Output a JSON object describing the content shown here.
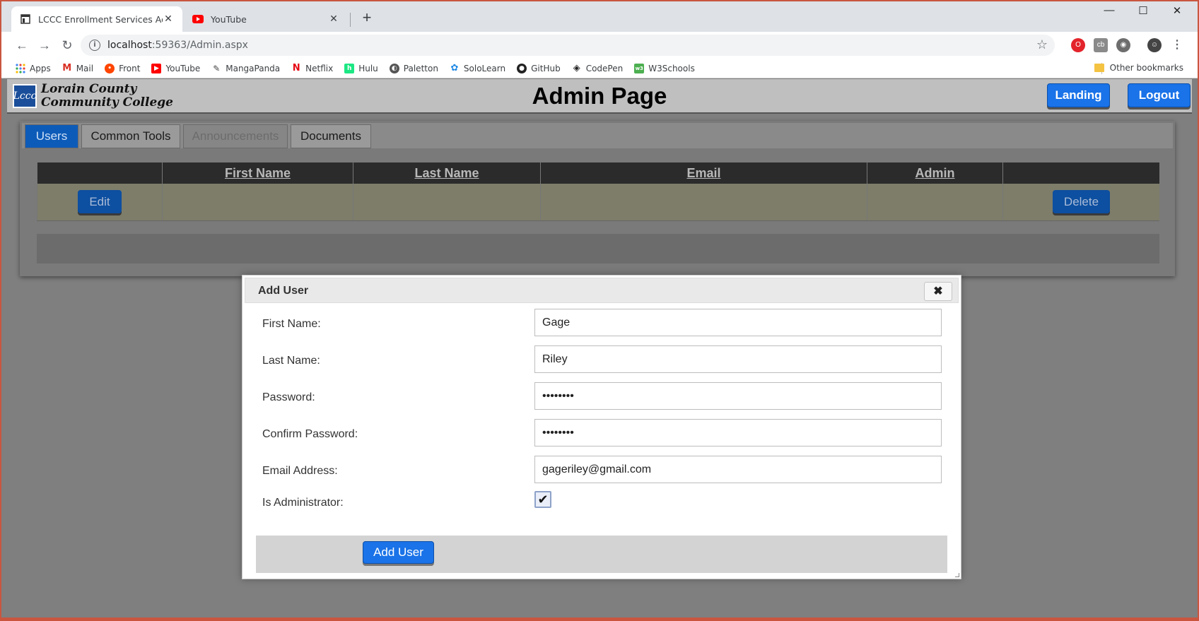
{
  "browser": {
    "tabs": [
      {
        "title": "LCCC Enrollment Services Admin",
        "active": true
      },
      {
        "title": "YouTube",
        "active": false
      }
    ],
    "url_host": "localhost",
    "url_rest": ":59363/Admin.aspx",
    "bookmarks": [
      {
        "label": "Apps",
        "icon": "apps-grid-icon",
        "color": "#4285f4"
      },
      {
        "label": "Mail",
        "icon": "gmail-icon",
        "color": "#d93025"
      },
      {
        "label": "Front",
        "icon": "reddit-icon",
        "color": "#ff4500"
      },
      {
        "label": "YouTube",
        "icon": "youtube-icon",
        "color": "#ff0000"
      },
      {
        "label": "MangaPanda",
        "icon": "mangapanda-icon",
        "color": "#444444"
      },
      {
        "label": "Netflix",
        "icon": "netflix-icon",
        "color": "#e50914"
      },
      {
        "label": "Hulu",
        "icon": "hulu-icon",
        "color": "#1ce783"
      },
      {
        "label": "Paletton",
        "icon": "paletton-icon",
        "color": "#555555"
      },
      {
        "label": "SoloLearn",
        "icon": "sololearn-icon",
        "color": "#1e88e5"
      },
      {
        "label": "GitHub",
        "icon": "github-icon",
        "color": "#222222"
      },
      {
        "label": "CodePen",
        "icon": "codepen-icon",
        "color": "#222222"
      },
      {
        "label": "W3Schools",
        "icon": "w3schools-icon",
        "color": "#4caf50"
      }
    ],
    "other_bookmarks": "Other bookmarks"
  },
  "header": {
    "logo_mark": "Lccc",
    "logo_line1": "Lorain County",
    "logo_line2": "Community College",
    "title": "Admin Page",
    "landing_label": "Landing",
    "logout_label": "Logout"
  },
  "panel": {
    "tabs": [
      "Users",
      "Common Tools",
      "Announcements",
      "Documents"
    ],
    "active_tab": "Users",
    "columns": [
      "",
      "First Name",
      "Last Name",
      "Email",
      "Admin",
      ""
    ],
    "row": {
      "edit_label": "Edit",
      "delete_label": "Delete"
    }
  },
  "modal": {
    "title": "Add User",
    "close_icon": "✖",
    "fields": {
      "first_name": {
        "label": "First Name:",
        "value": "Gage"
      },
      "last_name": {
        "label": "Last Name:",
        "value": "Riley"
      },
      "password": {
        "label": "Password:",
        "value": "••••••••"
      },
      "confirm_password": {
        "label": "Confirm Password:",
        "value": "••••••••"
      },
      "email": {
        "label": "Email Address:",
        "value": "gageriley@gmail.com"
      },
      "is_admin": {
        "label": "Is Administrator:",
        "checked": true
      }
    },
    "submit_label": "Add User"
  },
  "colors": {
    "accent": "#1a73e8",
    "overlay": "#7f7f7f",
    "window_frame": "#c9553f"
  }
}
